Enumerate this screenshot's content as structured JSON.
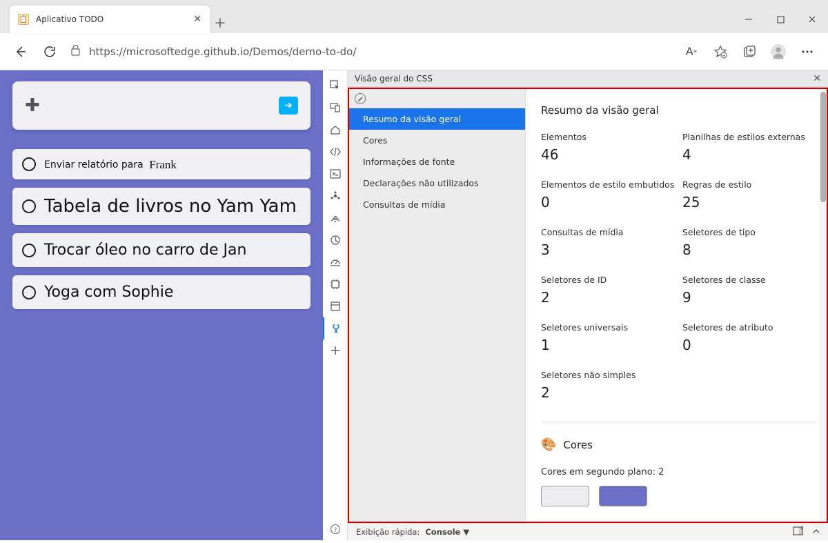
{
  "window": {
    "tab_title": "Aplicativo TODO"
  },
  "toolbar": {
    "url": "https://microsoftedge.github.io/Demos/demo-to-do/"
  },
  "todo": {
    "items": [
      {
        "text": "Enviar relatório para",
        "suffix": "Frank"
      },
      {
        "text": "Tabela de livros no Yam Yam"
      },
      {
        "text": "Trocar óleo no carro de Jan"
      },
      {
        "text": "Yoga com Sophie"
      }
    ]
  },
  "devtools": {
    "panel_title": "Visão geral do CSS",
    "nav": {
      "items": [
        "Resumo da visão geral",
        "Cores",
        "Informações de fonte",
        "Declarações não utilizados",
        "Consultas de mídia"
      ],
      "selected_index": 0
    },
    "summary": {
      "title": "Resumo da visão geral",
      "stats": [
        {
          "label": "Elementos",
          "value": "46"
        },
        {
          "label": "Planilhas de estilos externas",
          "value": "4"
        },
        {
          "label": "Elementos de estilo embutidos",
          "value": "0"
        },
        {
          "label": "Regras de estilo",
          "value": "25"
        },
        {
          "label": "Consultas de mídia",
          "value": "3"
        },
        {
          "label": "Seletores de tipo",
          "value": "8"
        },
        {
          "label": "Seletores de ID",
          "value": "2"
        },
        {
          "label": "Seletores de classe",
          "value": "9"
        },
        {
          "label": "Seletores universais",
          "value": "1"
        },
        {
          "label": "Seletores de atributo",
          "value": "0"
        },
        {
          "label": "Seletores não simples",
          "value": "2"
        }
      ],
      "colors_heading": "Cores",
      "bg_colors_label": "Cores em segundo plano: 2",
      "swatches": [
        "#ececf1",
        "#6b6fc6"
      ]
    },
    "footer": {
      "label": "Exibição rápida:",
      "value": "Console"
    }
  }
}
